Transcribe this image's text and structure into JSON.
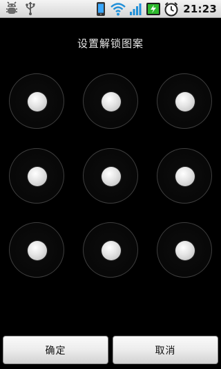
{
  "status_bar": {
    "time": "21:23",
    "left_icons": [
      "debug-bug-icon",
      "usb-icon"
    ],
    "right_icons": [
      "phone-sd-icon",
      "wifi-icon",
      "signal-icon",
      "battery-charging-icon",
      "alarm-clock-icon"
    ]
  },
  "title": "设置解锁图案",
  "pattern": {
    "rows": 3,
    "cols": 3,
    "connected_dots": 0
  },
  "buttons": {
    "confirm_label": "确定",
    "cancel_label": "取消"
  },
  "colors": {
    "background": "#000000",
    "ring": "#3f3f3f",
    "dot": "#e3e3e3",
    "battery_green": "#2db82d",
    "wifi_blue": "#1f8fd8"
  }
}
